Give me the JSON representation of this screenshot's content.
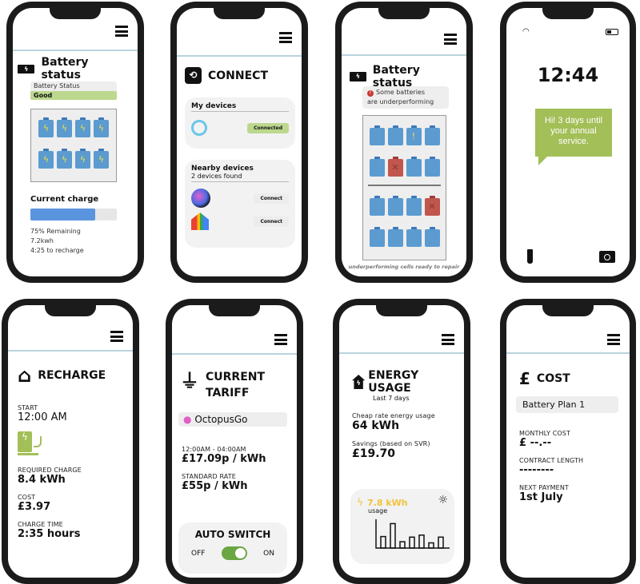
{
  "screens": {
    "battery_good": {
      "title": "Battery status",
      "status_label": "Battery Status",
      "status_value": "Good",
      "cells": [
        "good",
        "good",
        "good",
        "good",
        "good",
        "good",
        "good",
        "good"
      ],
      "charge_heading": "Current charge",
      "charge_percent": 75,
      "remaining": "75% Remaining",
      "energy": "7.2kwh",
      "recharge": "4:25 to recharge",
      "colors": {
        "good": "#bcd88f",
        "bar": "#5b94de"
      }
    },
    "connect": {
      "title": "CONNECT",
      "my_devices": "My devices",
      "device_status": "Connected",
      "nearby": "Nearby devices",
      "found": "2 devices found",
      "connect_label": "Connect",
      "icons": [
        "alexa-ring-icon",
        "siri-orb-icon",
        "google-home-icon"
      ]
    },
    "battery_warn": {
      "title": "Battery status",
      "warning_line1": "Some batteries",
      "warning_line2": "are underperforming",
      "cells_top": [
        "ok",
        "ok",
        "warn",
        "ok",
        "ok",
        "bad",
        "ok",
        "ok"
      ],
      "cells_bottom": [
        "ok",
        "ok",
        "ok",
        "bad",
        "ok",
        "ok",
        "ok",
        "ok"
      ],
      "caption": "underperforming cells ready to repair"
    },
    "lock": {
      "time": "12:44",
      "message": "Hi! 3 days until your annual service.",
      "bubble_color": "#a3bf58"
    },
    "recharge": {
      "title": "RECHARGE",
      "start_label": "START",
      "start_value": "12:00 AM",
      "required_label": "REQUIRED CHARGE",
      "required_value": "8.4 kWh",
      "cost_label": "COST",
      "cost_value": "£3.97",
      "time_label": "CHARGE TIME",
      "time_value": "2:35 hours"
    },
    "tariff": {
      "title_line1": "CURRENT",
      "title_line2": "TARIFF",
      "provider": "OctopusGo",
      "window_label": "12:00AM - 04:00AM",
      "window_rate": "£17.09p / kWh",
      "standard_label": "STANDARD RATE",
      "standard_rate": "£55p / kWh",
      "auto_switch": "AUTO SWITCH",
      "off": "OFF",
      "on": "ON",
      "auto_switch_on": true
    },
    "energy": {
      "title": "ENERGY USAGE",
      "subtitle": "Last 7 days",
      "cheap_label": "Cheap rate energy usage",
      "cheap_value": "64 kWh",
      "savings_label": "Savings (based on SVR)",
      "savings_value": "£19.70",
      "usage_value": "7.8 kWh",
      "usage_label": "usage",
      "usage_bars": [
        0.4,
        0.85,
        0.22,
        0.38,
        0.45,
        0.18,
        0.38
      ]
    },
    "cost": {
      "title": "COST",
      "plan": "Battery Plan 1",
      "monthly_label": "MONTHLY COST",
      "monthly_value": "£ --.--",
      "contract_label": "CONTRACT LENGTH",
      "contract_value": "--------",
      "next_label": "NEXT PAYMENT",
      "next_value": "1st July"
    }
  }
}
